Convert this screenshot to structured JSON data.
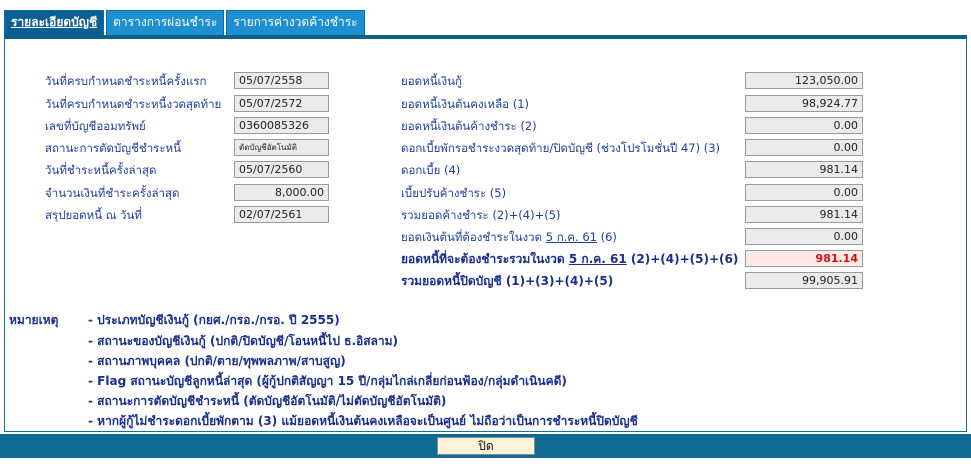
{
  "tabs": [
    {
      "label": "รายละเอียดบัญชี",
      "active": true
    },
    {
      "label": "ตารางการผ่อนชำระ",
      "active": false
    },
    {
      "label": "รายการค่างวดค้างชำระ",
      "active": false
    }
  ],
  "left": [
    {
      "label": "วันที่ครบกำหนดชำระหนี้ครั้งแรก",
      "value": "05/07/2558"
    },
    {
      "label": "วันที่ครบกำหนดชำระหนี้งวดสุดท้าย",
      "value": "05/07/2572"
    },
    {
      "label": "เลขที่บัญชีออมทรัพย์",
      "value": "0360085326"
    },
    {
      "label": "สถานะการตัดบัญชีชำระหนี้",
      "value": "ตัดบัญชีอัตโนมัติ"
    },
    {
      "label": "วันที่ชำระหนี้ครั้งล่าสุด",
      "value": "05/07/2560"
    },
    {
      "label": "จำนวนเงินที่ชำระครั้งล่าสุด",
      "value": "8,000.00"
    },
    {
      "label": "สรุปยอดหนี้ ณ วันที่",
      "value": "02/07/2561"
    }
  ],
  "right": [
    {
      "label": "ยอดหนี้เงินกู้",
      "value": "123,050.00"
    },
    {
      "label": "ยอดหนี้เงินต้นคงเหลือ (1)",
      "value": "98,924.77"
    },
    {
      "label": "ยอดหนี้เงินต้นค้างชำระ (2)",
      "value": "0.00"
    },
    {
      "label": "ดอกเบี้ยพักรอชำระงวดสุดท้าย/ปิดบัญชี (ช่วงโปรโมชั่นปี 47) (3)",
      "value": "0.00"
    },
    {
      "label": "ดอกเบี้ย (4)",
      "value": "981.14"
    },
    {
      "label": "เบี้ยปรับค้างชำระ (5)",
      "value": "0.00"
    },
    {
      "label": "รวมยอดค้างชำระ (2)+(4)+(5)",
      "value": "981.14"
    },
    {
      "label_pre": "ยอดเงินต้นที่ต้องชำระในงวด",
      "label_date": "5 ก.ค. 61",
      "label_post": "(6)",
      "value": "0.00"
    },
    {
      "label_pre": "ยอดหนี้ที่จะต้องชำระรวมในงวด",
      "label_date": "5 ก.ค. 61",
      "label_post": "(2)+(4)+(5)+(6)",
      "value": "981.14"
    },
    {
      "label": "รวมยอดหนี้ปิดบัญชี (1)+(3)+(4)+(5)",
      "value": "99,905.91"
    }
  ],
  "notes": {
    "title": "หมายเหตุ",
    "items": [
      "- ประเภทบัญชีเงินกู้ (กยศ./กรอ./กรอ. ปี 2555)",
      "- สถานะของบัญชีเงินกู้ (ปกติ/ปิดบัญชี/โอนหนี้ไป ธ.อิสลาม)",
      "- สถานภาพบุคคล (ปกติ/ตาย/ทุพพลภาพ/สาบสูญ)",
      "- Flag สถานะบัญชีลูกหนี้ล่าสุด (ผู้กู้ปกติสัญญา 15 ปี/กลุ่มไกล่เกลี่ยก่อนฟ้อง/กลุ่มดำเนินคดี)",
      "- สถานะการตัดบัญชีชำระหนี้ (ตัดบัญชีอัตโนมัติ/ไม่ตัดบัญชีอัตโนมัติ)",
      "- หากผู้กู้ไม่ชำระดอกเบี้ยพักตาม (3) แม้ยอดหนี้เงินต้นคงเหลือจะเป็นศูนย์ ไม่ถือว่าเป็นการชำระหนี้ปิดบัญชี"
    ]
  },
  "footer": {
    "close_label": "ปิด"
  },
  "colors": {
    "tab": "#1e8fd0",
    "tab_active": "#0c5f92",
    "footer": "#0f6a94",
    "label": "#1f3f99",
    "highlight": "#d01010"
  }
}
